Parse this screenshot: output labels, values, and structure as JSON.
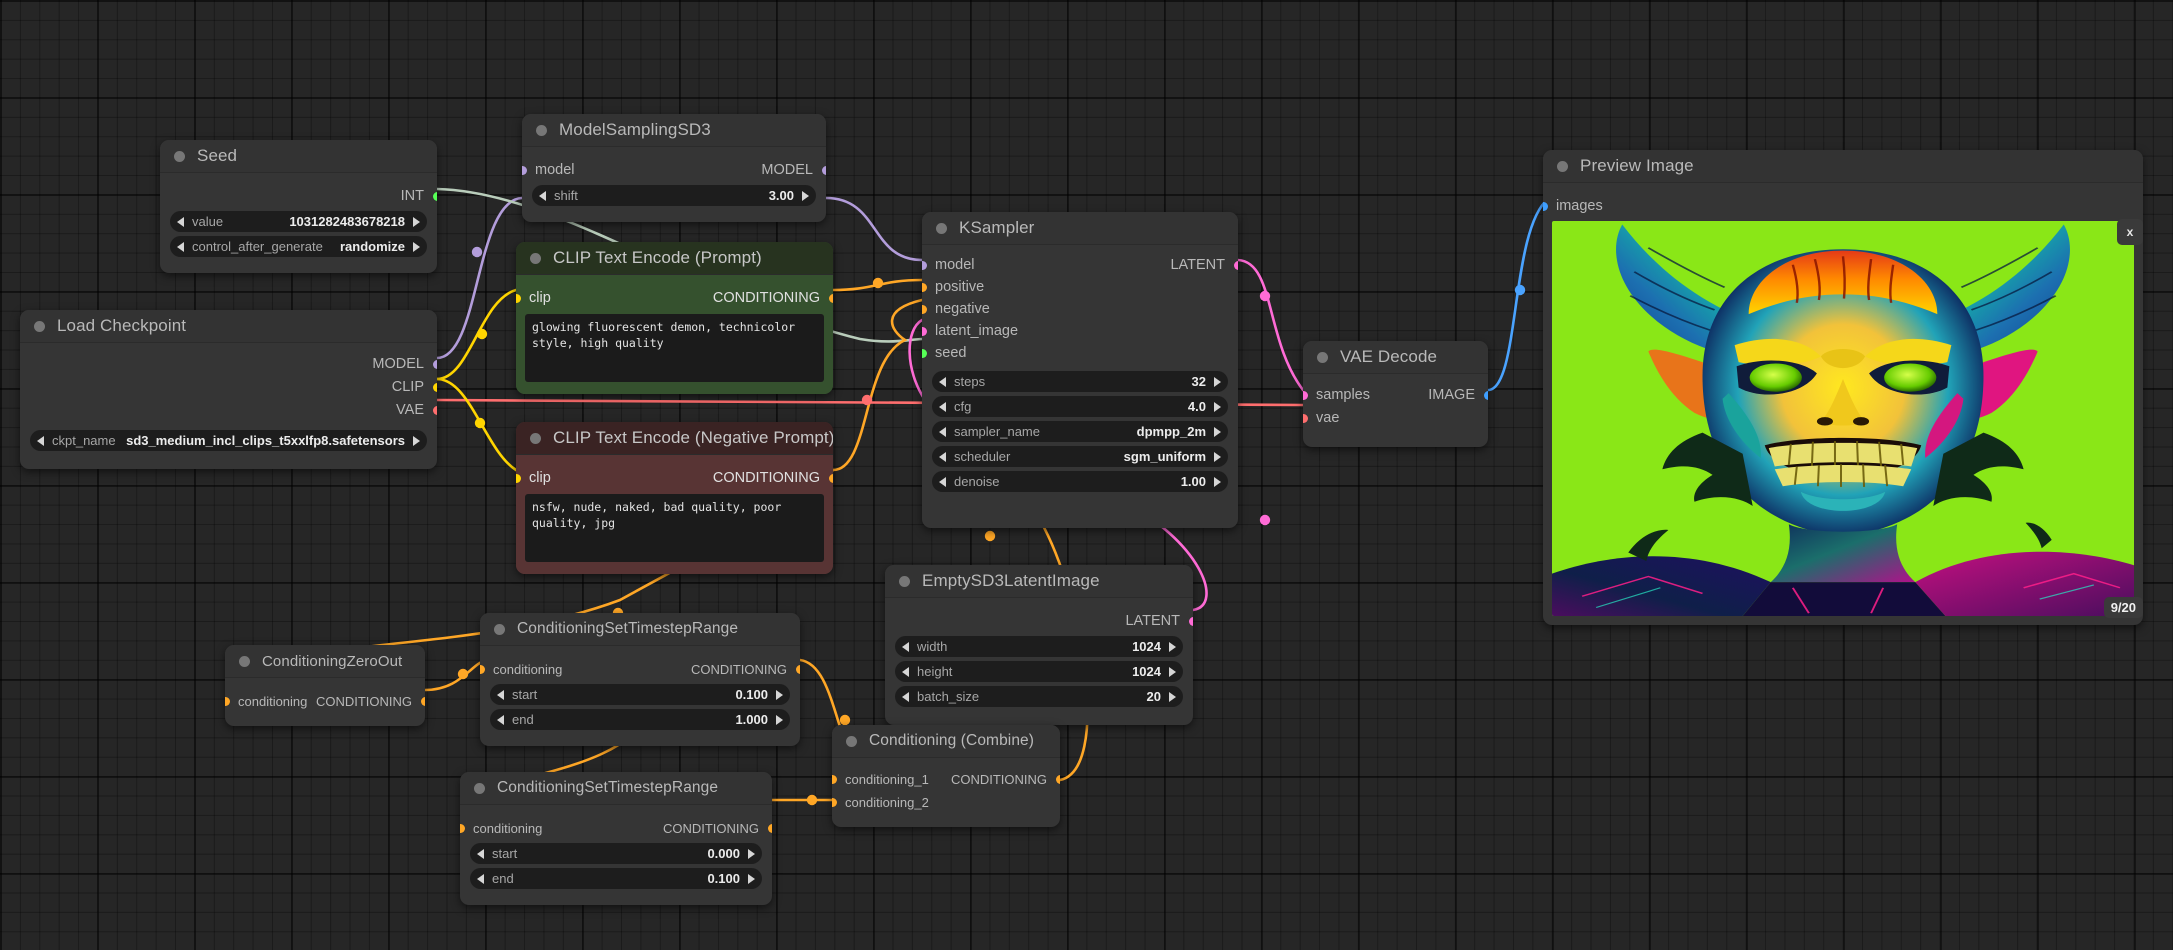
{
  "app": {
    "name": "ComfyUI node graph canvas"
  },
  "colors": {
    "model": "#b39ddb",
    "clip": "#ffd500",
    "vae": "#ff6e6e",
    "conditioning": "#ffa726",
    "latent": "#ff6bd6",
    "image": "#3f9fff",
    "int": "#56ff56",
    "node_bg": "#353535",
    "node_title": "#333333",
    "green_node": "#35512e",
    "red_node": "#583434"
  },
  "nodes": {
    "seed": {
      "title": "Seed",
      "outputs": [
        {
          "label": "INT",
          "type": "int"
        }
      ],
      "widgets": [
        {
          "name": "value",
          "value": "1031282483678218"
        },
        {
          "name": "control_after_generate",
          "value": "randomize"
        }
      ]
    },
    "load_checkpoint": {
      "title": "Load Checkpoint",
      "outputs": [
        {
          "label": "MODEL",
          "type": "model"
        },
        {
          "label": "CLIP",
          "type": "clip"
        },
        {
          "label": "VAE",
          "type": "vae"
        }
      ],
      "widgets": [
        {
          "name": "ckpt_name",
          "value": "sd3_medium_incl_clips_t5xxlfp8.safetensors"
        }
      ]
    },
    "model_sampling": {
      "title": "ModelSamplingSD3",
      "inputs": [
        {
          "label": "model",
          "type": "model"
        }
      ],
      "outputs": [
        {
          "label": "MODEL",
          "type": "model"
        }
      ],
      "widgets": [
        {
          "name": "shift",
          "value": "3.00"
        }
      ]
    },
    "clip_positive": {
      "title": "CLIP Text Encode (Prompt)",
      "inputs": [
        {
          "label": "clip",
          "type": "clip"
        }
      ],
      "outputs": [
        {
          "label": "CONDITIONING",
          "type": "conditioning"
        }
      ],
      "text": "glowing fluorescent demon, technicolor style, high quality"
    },
    "clip_negative": {
      "title": "CLIP Text Encode (Negative Prompt)",
      "inputs": [
        {
          "label": "clip",
          "type": "clip"
        }
      ],
      "outputs": [
        {
          "label": "CONDITIONING",
          "type": "conditioning"
        }
      ],
      "text": "nsfw, nude, naked, bad quality, poor quality, jpg"
    },
    "ksampler": {
      "title": "KSampler",
      "inputs": [
        {
          "label": "model",
          "type": "model"
        },
        {
          "label": "positive",
          "type": "conditioning"
        },
        {
          "label": "negative",
          "type": "conditioning"
        },
        {
          "label": "latent_image",
          "type": "latent"
        },
        {
          "label": "seed",
          "type": "int"
        }
      ],
      "outputs": [
        {
          "label": "LATENT",
          "type": "latent"
        }
      ],
      "widgets": [
        {
          "name": "steps",
          "value": "32"
        },
        {
          "name": "cfg",
          "value": "4.0"
        },
        {
          "name": "sampler_name",
          "value": "dpmpp_2m"
        },
        {
          "name": "scheduler",
          "value": "sgm_uniform"
        },
        {
          "name": "denoise",
          "value": "1.00"
        }
      ]
    },
    "vae_decode": {
      "title": "VAE Decode",
      "inputs": [
        {
          "label": "samples",
          "type": "latent"
        },
        {
          "label": "vae",
          "type": "vae"
        }
      ],
      "outputs": [
        {
          "label": "IMAGE",
          "type": "image"
        }
      ]
    },
    "empty_latent": {
      "title": "EmptySD3LatentImage",
      "outputs": [
        {
          "label": "LATENT",
          "type": "latent"
        }
      ],
      "widgets": [
        {
          "name": "width",
          "value": "1024"
        },
        {
          "name": "height",
          "value": "1024"
        },
        {
          "name": "batch_size",
          "value": "20"
        }
      ]
    },
    "cond_zero_out": {
      "title": "ConditioningZeroOut",
      "inputs": [
        {
          "label": "conditioning",
          "type": "conditioning"
        }
      ],
      "outputs": [
        {
          "label": "CONDITIONING",
          "type": "conditioning"
        }
      ]
    },
    "cond_range_1": {
      "title": "ConditioningSetTimestepRange",
      "inputs": [
        {
          "label": "conditioning",
          "type": "conditioning"
        }
      ],
      "outputs": [
        {
          "label": "CONDITIONING",
          "type": "conditioning"
        }
      ],
      "widgets": [
        {
          "name": "start",
          "value": "0.100"
        },
        {
          "name": "end",
          "value": "1.000"
        }
      ]
    },
    "cond_range_2": {
      "title": "ConditioningSetTimestepRange",
      "inputs": [
        {
          "label": "conditioning",
          "type": "conditioning"
        }
      ],
      "outputs": [
        {
          "label": "CONDITIONING",
          "type": "conditioning"
        }
      ],
      "widgets": [
        {
          "name": "start",
          "value": "0.000"
        },
        {
          "name": "end",
          "value": "0.100"
        }
      ]
    },
    "cond_combine": {
      "title": "Conditioning (Combine)",
      "inputs": [
        {
          "label": "conditioning_1",
          "type": "conditioning"
        },
        {
          "label": "conditioning_2",
          "type": "conditioning"
        }
      ],
      "outputs": [
        {
          "label": "CONDITIONING",
          "type": "conditioning"
        }
      ]
    },
    "preview_image": {
      "title": "Preview Image",
      "inputs": [
        {
          "label": "images",
          "type": "image"
        }
      ],
      "close_label": "x",
      "counter": "9/20"
    }
  }
}
